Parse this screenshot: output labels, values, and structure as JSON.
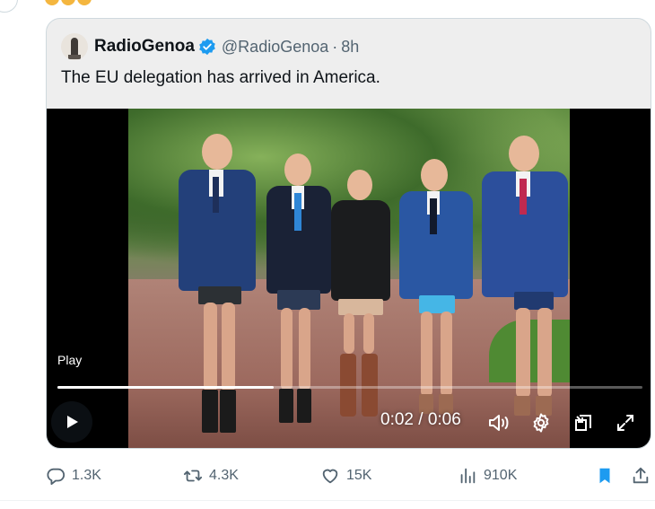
{
  "quote": {
    "author_name": "RadioGenoa",
    "author_handle": "@RadioGenoa",
    "separator": "·",
    "time": "8h",
    "text": "The EU delegation has arrived in America."
  },
  "video": {
    "play_label": "Play",
    "current_time": "0:02",
    "duration": "0:06",
    "time_separator": " / ",
    "progress_fraction": 0.37
  },
  "actions": {
    "replies": "1.3K",
    "reposts": "4.3K",
    "likes": "15K",
    "views": "910K"
  },
  "colors": {
    "verified_badge": "#1d9bf0",
    "bookmark_active": "#1d9bf0",
    "muted_text": "#536471",
    "card_border": "#cfd9de"
  },
  "icons": [
    "verified-badge-icon",
    "play-icon",
    "volume-icon",
    "settings-gear-icon",
    "picture-in-picture-icon",
    "fullscreen-icon",
    "reply-icon",
    "repost-icon",
    "like-heart-icon",
    "views-analytics-icon",
    "bookmark-icon",
    "share-icon"
  ]
}
